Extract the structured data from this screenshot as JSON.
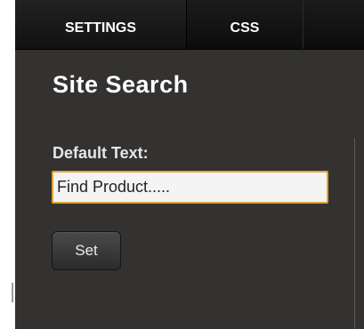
{
  "tabs": [
    {
      "label": "SETTINGS",
      "active": true
    },
    {
      "label": "CSS",
      "active": false
    }
  ],
  "section": {
    "title": "Site Search"
  },
  "form": {
    "default_text_label": "Default Text:",
    "default_text_value": "Find Product.....",
    "set_button_label": "Set"
  },
  "colors": {
    "panel_bg": "#333231",
    "tabbar_bg": "#111111",
    "input_focus_border": "#e0a233",
    "text": "#ffffff"
  }
}
